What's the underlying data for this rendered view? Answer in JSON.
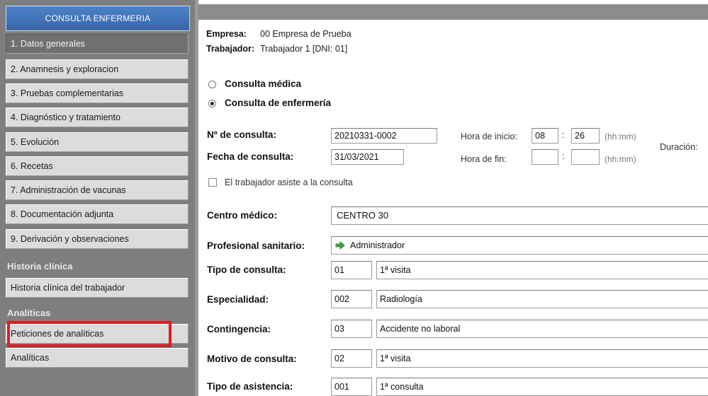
{
  "sidebar": {
    "header": "CONSULTA ENFERMERIA",
    "items": [
      {
        "label": "1. Datos generales"
      },
      {
        "label": "2. Anamnesis y exploracion"
      },
      {
        "label": "3. Pruebas complementarias"
      },
      {
        "label": "4. Diagnóstico y tratamiento"
      },
      {
        "label": "5. Evolución"
      },
      {
        "label": "6. Recetas"
      },
      {
        "label": "7. Administración de vacunas"
      },
      {
        "label": "8. Documentación adjunta"
      },
      {
        "label": "9. Derivación y observaciones"
      }
    ],
    "section_historia": "Historia clínica",
    "historia_items": [
      {
        "label": "Historia clínica del trabajador"
      }
    ],
    "section_analiticas": "Analíticas",
    "analiticas_items": [
      {
        "label": "Peticiones de analíticas"
      },
      {
        "label": "Analíticas"
      }
    ],
    "highlight_color": "#e01c24"
  },
  "header": {
    "empresa_label": "Empresa:",
    "empresa_value": "00 Empresa de Prueba",
    "trabajador_label": "Trabajador:",
    "trabajador_value": "Trabajador 1 [DNI: 01]"
  },
  "consulta_type": {
    "option_medica": "Consulta médica",
    "option_enfermeria": "Consulta de enfermería",
    "selected": "Consulta de enfermería"
  },
  "form": {
    "num_consulta_label": "Nº de consulta:",
    "num_consulta_value": "20210331-0002",
    "fecha_label": "Fecha de consulta:",
    "fecha_value": "31/03/2021",
    "hora_inicio_label": "Hora de inicio:",
    "hora_inicio_h": "08",
    "hora_inicio_m": "26",
    "hora_fin_label": "Hora de fin:",
    "hora_fin_h": "",
    "hora_fin_m": "",
    "time_sep": ":",
    "time_hint": "(hh:mm)",
    "duracion_label": "Duración:",
    "asiste_label": "El trabajador asiste a la consulta",
    "centro_label": "Centro médico:",
    "centro_value": "CENTRO 30",
    "profesional_label": "Profesional sanitario:",
    "profesional_value": "Administrador",
    "tipo_label": "Tipo de consulta:",
    "tipo_code": "01",
    "tipo_value": "1ª visita",
    "especialidad_label": "Especialidad:",
    "especialidad_code": "002",
    "especialidad_value": "Radiología",
    "contingencia_label": "Contingencia:",
    "contingencia_code": "03",
    "contingencia_value": "Accidente no laboral",
    "motivo_label": "Motivo de consulta:",
    "motivo_code": "02",
    "motivo_value": "1ª visita",
    "asistencia_label": "Tipo de asistencia:",
    "asistencia_code": "001",
    "asistencia_value": "1ª consulta"
  },
  "icons": {
    "profesional": "green-arrow-right-icon"
  }
}
